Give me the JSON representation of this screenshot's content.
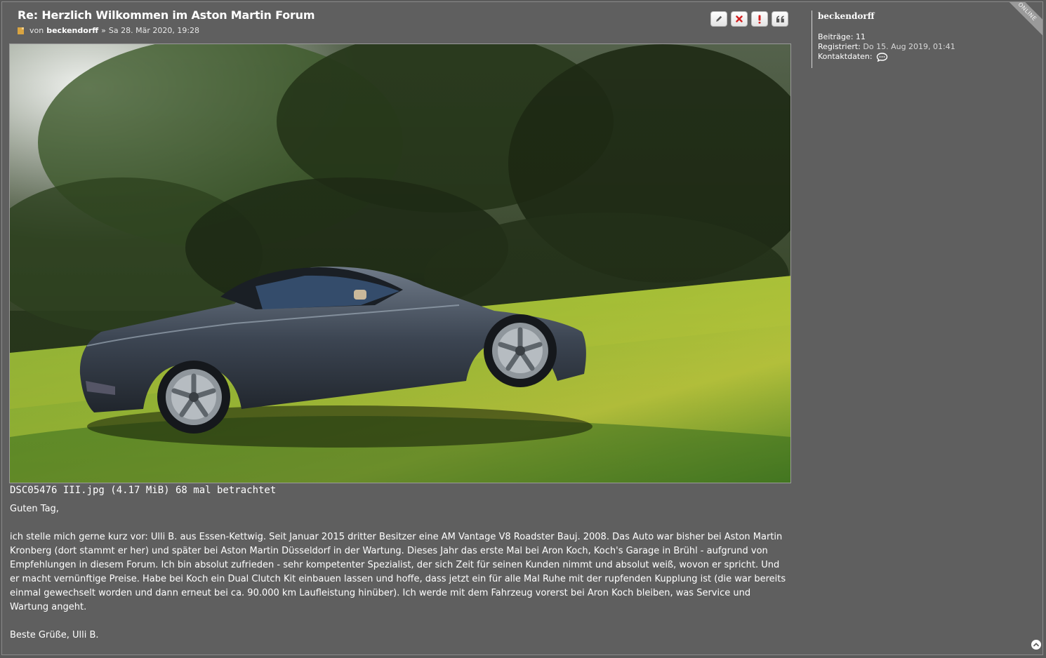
{
  "post": {
    "title": "Re: Herzlich Wilkommen im Aston Martin Forum",
    "meta_prefix": "von",
    "author": "beckendorff",
    "meta_separator": "»",
    "date": "Sa 28. Mär 2020, 19:28"
  },
  "actions": {
    "edit_icon": "pencil-icon",
    "delete_icon": "x-icon",
    "report_icon": "exclamation-icon",
    "quote_icon": "quote-icon"
  },
  "attachment": {
    "file_info": "DSC05476 III.jpg (4.17 MiB) 68 mal betrachtet"
  },
  "body": {
    "greeting": "Guten Tag,",
    "paragraph": "ich stelle mich gerne kurz vor: Ulli B. aus Essen-Kettwig. Seit Januar 2015 dritter Besitzer eine AM Vantage V8 Roadster Bauj. 2008. Das Auto war bisher bei Aston Martin Kronberg (dort stammt er her) und später bei Aston Martin Düsseldorf in der Wartung. Dieses Jahr das erste Mal bei Aron Koch, Koch's Garage in Brühl - aufgrund von Empfehlungen in diesem Forum. Ich bin absolut zufrieden - sehr kompetenter Spezialist, der sich Zeit für seinen Kunden nimmt und absolut weiß, wovon er spricht. Und er macht vernünftige Preise. Habe bei Koch ein Dual Clutch Kit einbauen lassen und hoffe, dass jetzt ein für alle Mal Ruhe mit der rupfenden Kupplung ist (die war bereits einmal gewechselt worden und dann erneut bei ca. 90.000 km Laufleistung hinüber). Ich werde mit dem Fahrzeug vorerst bei Aron Koch bleiben, was Service und Wartung angeht.",
    "closing": "Beste Grüße, Ulli B."
  },
  "profile": {
    "username": "beckendorff",
    "posts_label": "Beiträge:",
    "posts_value": "11",
    "registered_label": "Registriert:",
    "registered_value": "Do 15. Aug 2019, 01:41",
    "contact_label": "Kontaktdaten:",
    "contact_icon": "chat-bubble-icon"
  },
  "status": {
    "online_label": "ONLINE"
  },
  "back_to_top_icon": "arrow-up-icon"
}
